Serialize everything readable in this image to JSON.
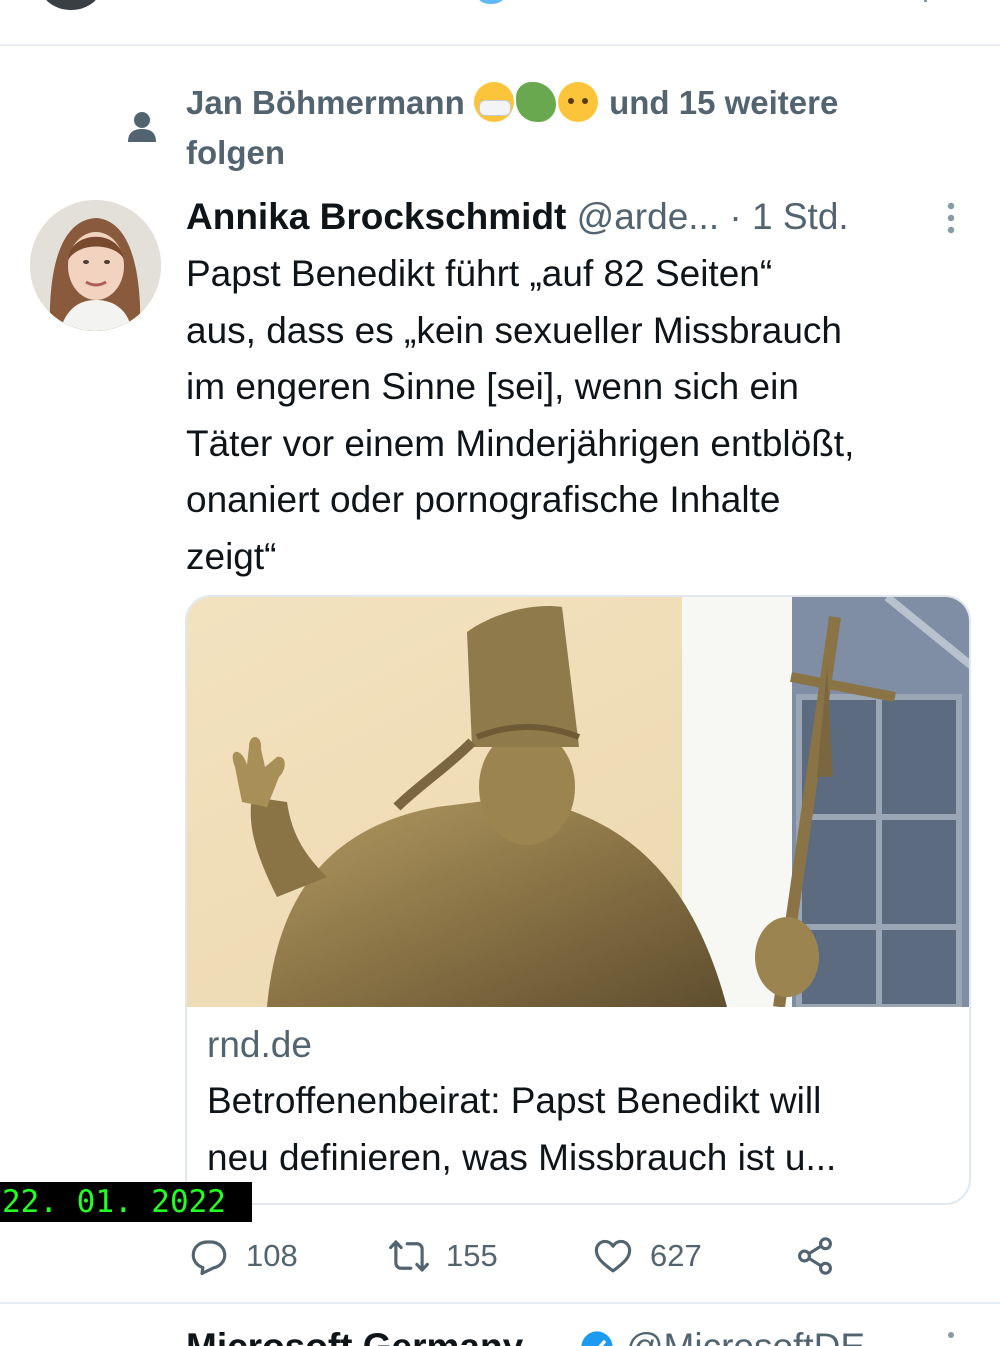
{
  "social_context": {
    "name": "Jan Böhmermann",
    "emojis": [
      "face-with-medical-mask-icon",
      "microbe-icon",
      "face-with-raised-eyebrow-icon"
    ],
    "suffix": "und 15 weitere",
    "line2": "folgen"
  },
  "tweet": {
    "author_name": "Annika Brockschmidt",
    "handle": "@arde...",
    "separator": "·",
    "time": "1 Std.",
    "text": "Papst Benedikt führt „auf 82 Seiten“\naus, dass es „kein sexueller Missbrauch\nim engeren Sinne [sei], wenn sich ein\nTäter vor einem Minderjährigen entblößt,\nonaniert oder pornografische Inhalte\nzeigt“",
    "card": {
      "domain": "rnd.de",
      "title": "Betroffenenbeirat: Papst Benedikt will\nneu definieren, was Missbrauch ist u..."
    },
    "stats": {
      "replies": "108",
      "retweets": "155",
      "likes": "627"
    }
  },
  "date_stamp": "22. 01. 2022",
  "next_tweet": {
    "author_name": "Microsoft Germany",
    "handle": "@MicrosoftDE"
  },
  "colors": {
    "text_primary": "#0f1419",
    "text_secondary": "#536471",
    "border": "#e1e8ed",
    "verified": "#1d9bf0",
    "date_stamp_text": "#23ff23"
  }
}
